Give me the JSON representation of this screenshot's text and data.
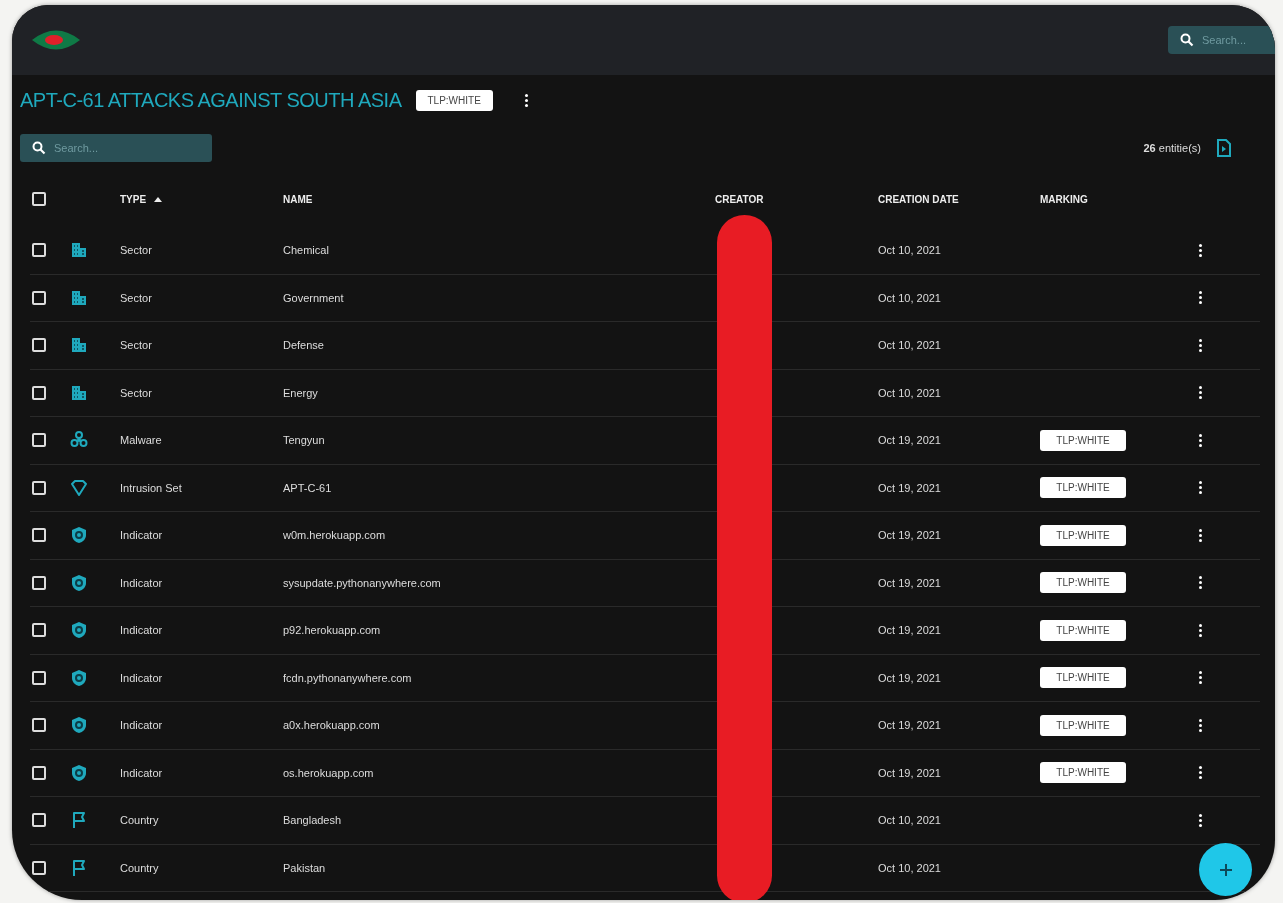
{
  "top_bar": {
    "search": {
      "placeholder": "Search..."
    }
  },
  "header": {
    "title": "APT-C-61 ATTACKS AGAINST SOUTH ASIA",
    "marking": "TLP:WHITE"
  },
  "toolbar": {
    "search": {
      "placeholder": "Search..."
    },
    "count": "**26** entitie(s)"
  },
  "table": {
    "select_all": {
      "checked": false
    },
    "columns": [
      {
        "label": "TYPE",
        "sorted": true
      },
      {
        "label": "NAME"
      },
      {
        "label": "CREATOR"
      },
      {
        "label": "CREATION DATE"
      },
      {
        "label": "MARKING"
      }
    ],
    "rows": [
      {
        "kind": "sector",
        "checked": false,
        "type": "Sector",
        "name": "Chemical",
        "date": "Oct 10, 2021",
        "has_menu": true
      },
      {
        "kind": "sector",
        "checked": false,
        "type": "Sector",
        "name": "Government",
        "date": "Oct 10, 2021",
        "has_menu": true
      },
      {
        "kind": "sector",
        "checked": false,
        "type": "Sector",
        "name": "Defense",
        "date": "Oct 10, 2021",
        "has_menu": true
      },
      {
        "kind": "sector",
        "checked": false,
        "type": "Sector",
        "name": "Energy",
        "date": "Oct 10, 2021",
        "has_menu": true
      },
      {
        "kind": "malware",
        "checked": false,
        "type": "Malware",
        "name": "Tengyun",
        "date": "Oct 19, 2021",
        "marking": "TLP:WHITE",
        "has_menu": true
      },
      {
        "kind": "intrusion-set",
        "checked": false,
        "type": "Intrusion Set",
        "name": "APT-C-61",
        "date": "Oct 19, 2021",
        "marking": "TLP:WHITE",
        "has_menu": true
      },
      {
        "kind": "indicator",
        "checked": false,
        "type": "Indicator",
        "name": "w0m.herokuapp.com",
        "date": "Oct 19, 2021",
        "marking": "TLP:WHITE",
        "has_menu": true
      },
      {
        "kind": "indicator",
        "checked": false,
        "type": "Indicator",
        "name": "sysupdate.pythonanywhere.com",
        "date": "Oct 19, 2021",
        "marking": "TLP:WHITE",
        "has_menu": true
      },
      {
        "kind": "indicator",
        "checked": false,
        "type": "Indicator",
        "name": "p92.herokuapp.com",
        "date": "Oct 19, 2021",
        "marking": "TLP:WHITE",
        "has_menu": true
      },
      {
        "kind": "indicator",
        "checked": false,
        "type": "Indicator",
        "name": "fcdn.pythonanywhere.com",
        "date": "Oct 19, 2021",
        "marking": "TLP:WHITE",
        "has_menu": true
      },
      {
        "kind": "indicator",
        "checked": false,
        "type": "Indicator",
        "name": "a0x.herokuapp.com",
        "date": "Oct 19, 2021",
        "marking": "TLP:WHITE",
        "has_menu": true
      },
      {
        "kind": "indicator",
        "checked": false,
        "type": "Indicator",
        "name": "os.herokuapp.com",
        "date": "Oct 19, 2021",
        "marking": "TLP:WHITE",
        "has_menu": true
      },
      {
        "kind": "country",
        "checked": false,
        "type": "Country",
        "name": "Bangladesh",
        "date": "Oct 10, 2021",
        "has_menu": true
      },
      {
        "kind": "country",
        "checked": false,
        "type": "Country",
        "name": "Pakistan",
        "date": "Oct 10, 2021",
        "has_menu": false
      }
    ]
  }
}
